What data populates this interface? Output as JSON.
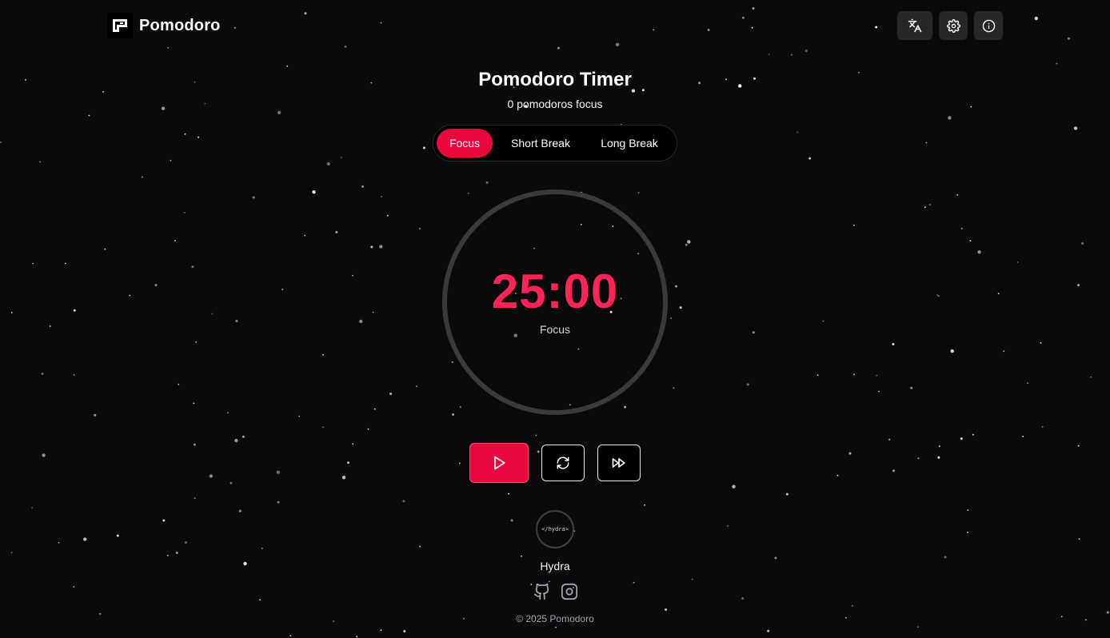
{
  "app": {
    "name": "Pomodoro",
    "logo_icon": "pomodoro-logo-icon"
  },
  "header": {
    "actions": [
      {
        "icon": "translate-icon"
      },
      {
        "icon": "gear-icon"
      },
      {
        "icon": "info-icon"
      }
    ]
  },
  "timer_page": {
    "title": "Pomodoro Timer",
    "subtitle": "0 pomodoros focus",
    "tabs": [
      {
        "label": "Focus",
        "active": true
      },
      {
        "label": "Short Break",
        "active": false
      },
      {
        "label": "Long Break",
        "active": false
      }
    ],
    "time": "25:00",
    "mode": "Focus"
  },
  "controls": {
    "play_icon": "play-icon",
    "reset_icon": "refresh-icon",
    "skip_icon": "fast-forward-icon"
  },
  "author": {
    "avatar_text": "</hydra>",
    "name": "Hydra",
    "social_icons": [
      "github-icon",
      "instagram-icon"
    ]
  },
  "footer": {
    "copyright": "© 2025 Pomodoro"
  },
  "colors": {
    "background": "#0a0a0a",
    "accent": "#e8083e",
    "timer_text": "#ff2458",
    "ring": "#3a3a3a",
    "button_surface": "#27272a"
  }
}
